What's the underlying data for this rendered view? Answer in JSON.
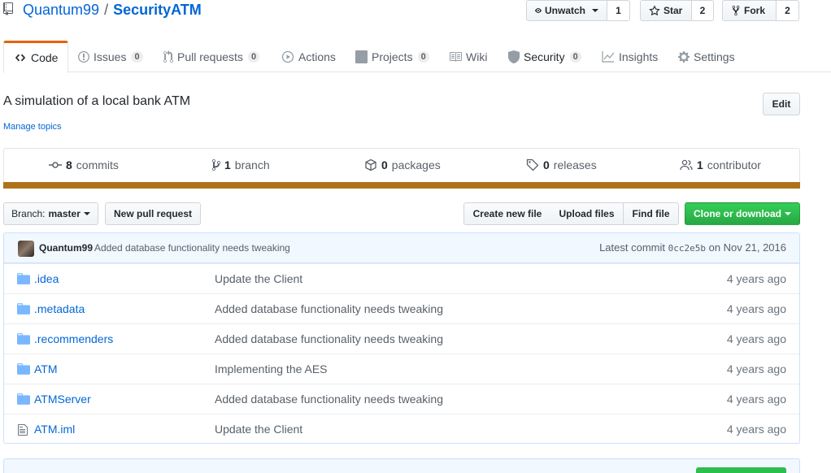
{
  "repo": {
    "owner": "Quantum99",
    "separator": "/",
    "name": "SecurityATM"
  },
  "actions": {
    "watch": {
      "label": "Unwatch",
      "count": "1"
    },
    "star": {
      "label": "Star",
      "count": "2"
    },
    "fork": {
      "label": "Fork",
      "count": "2"
    }
  },
  "tabs": [
    {
      "label": "Code",
      "icon": "code-icon"
    },
    {
      "label": "Issues",
      "counter": "0",
      "icon": "issue-icon"
    },
    {
      "label": "Pull requests",
      "counter": "0",
      "icon": "pull-request-icon"
    },
    {
      "label": "Actions",
      "icon": "play-icon"
    },
    {
      "label": "Projects",
      "counter": "0",
      "icon": "project-icon"
    },
    {
      "label": "Wiki",
      "icon": "book-icon"
    },
    {
      "label": "Security",
      "counter": "0",
      "icon": "shield-icon"
    },
    {
      "label": "Insights",
      "icon": "graph-icon"
    },
    {
      "label": "Settings",
      "icon": "gear-icon"
    }
  ],
  "about": {
    "description": "A simulation of a local bank ATM",
    "manage_topics": "Manage topics",
    "edit": "Edit"
  },
  "summary": [
    {
      "count": "8",
      "label": "commits",
      "icon": "history-icon"
    },
    {
      "count": "1",
      "label": "branch",
      "icon": "branch-icon"
    },
    {
      "count": "0",
      "label": "packages",
      "icon": "package-icon"
    },
    {
      "count": "0",
      "label": "releases",
      "icon": "tag-icon"
    },
    {
      "count": "1",
      "label": "contributor",
      "icon": "people-icon"
    }
  ],
  "language_color": "#b07219",
  "file_nav": {
    "branch_prefix": "Branch:",
    "branch": "master",
    "new_pull_request": "New pull request",
    "create_new_file": "Create new file",
    "upload_files": "Upload files",
    "find_file": "Find file",
    "clone": "Clone or download"
  },
  "commit": {
    "author": "Quantum99",
    "message": "Added database functionality needs tweaking",
    "latest_prefix": "Latest commit",
    "sha": "0cc2e5b",
    "date": "on Nov 21, 2016"
  },
  "files": [
    {
      "type": "dir",
      "name": ".idea",
      "message": "Update the Client",
      "age": "4 years ago"
    },
    {
      "type": "dir",
      "name": ".metadata",
      "message": "Added database functionality needs tweaking",
      "age": "4 years ago"
    },
    {
      "type": "dir",
      "name": ".recommenders",
      "message": "Added database functionality needs tweaking",
      "age": "4 years ago"
    },
    {
      "type": "dir",
      "name": "ATM",
      "message": "Implementing the AES",
      "age": "4 years ago"
    },
    {
      "type": "dir",
      "name": "ATMServer",
      "message": "Added database functionality needs tweaking",
      "age": "4 years ago"
    },
    {
      "type": "file",
      "name": "ATM.iml",
      "message": "Update the Client",
      "age": "4 years ago"
    }
  ]
}
